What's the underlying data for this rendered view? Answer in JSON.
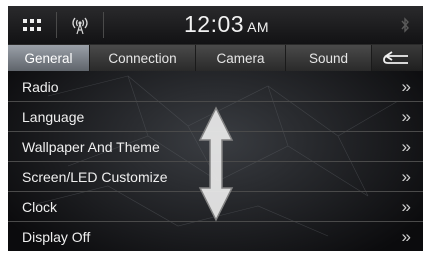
{
  "status_bar": {
    "menu_icon": "grid-menu-icon",
    "antenna_icon": "signal-antenna-icon",
    "time": "12:03",
    "ampm": "AM",
    "bluetooth_icon": "bluetooth-icon"
  },
  "tabs": [
    {
      "label": "General",
      "active": true
    },
    {
      "label": "Connection",
      "active": false
    },
    {
      "label": "Camera",
      "active": false
    },
    {
      "label": "Sound",
      "active": false
    }
  ],
  "back_icon": "back-arrow-icon",
  "menu_items": [
    {
      "label": "Radio"
    },
    {
      "label": "Language"
    },
    {
      "label": "Wallpaper And Theme"
    },
    {
      "label": "Screen/LED Customize"
    },
    {
      "label": "Clock"
    },
    {
      "label": "Display Off"
    }
  ],
  "chevron_glyph": "»",
  "scroll_hint_icon": "up-down-arrow-icon",
  "colors": {
    "background": "#0b0b0d",
    "tab_active": "#7d838b",
    "text": "#f0f0f0"
  }
}
